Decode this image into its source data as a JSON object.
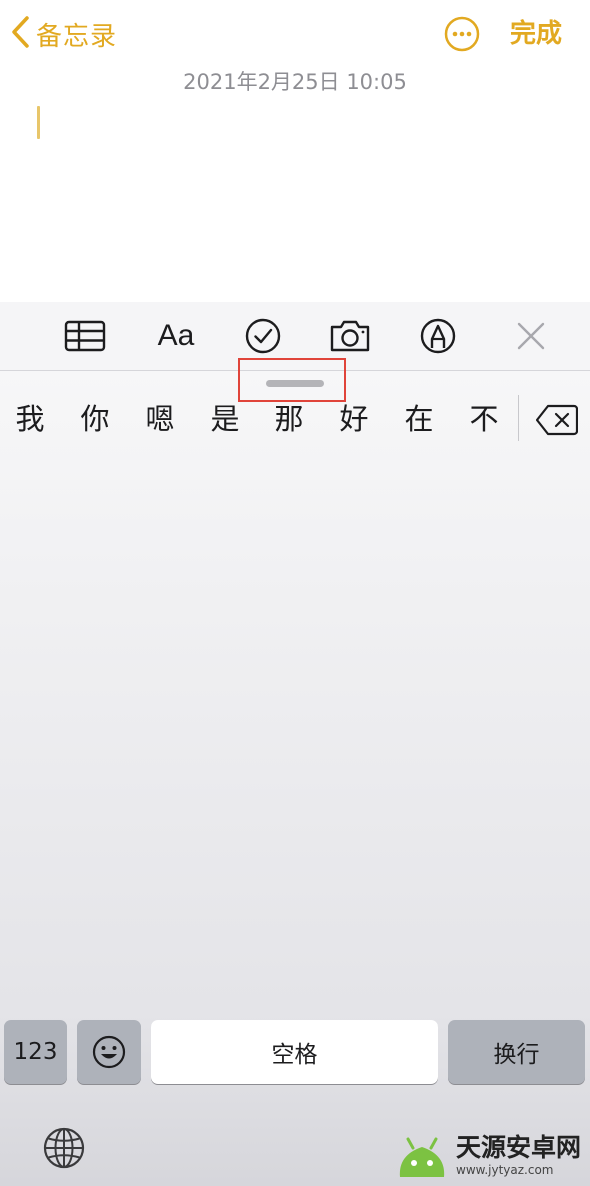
{
  "nav": {
    "back_label": "备忘录",
    "done_label": "完成"
  },
  "note": {
    "timestamp": "2021年2月25日 10:05"
  },
  "toolbar": {
    "items": [
      "table-icon",
      "text-format",
      "checklist-icon",
      "camera-icon",
      "markup-icon",
      "close-icon"
    ],
    "text_format_label": "Aa"
  },
  "candidates": [
    "我",
    "你",
    "嗯",
    "是",
    "那",
    "好",
    "在",
    "不"
  ],
  "keyboard": {
    "numbers_label": "123",
    "space_label": "空格",
    "return_label": "换行"
  },
  "watermark": {
    "title": "天源安卓网",
    "url": "www.jytyaz.com"
  },
  "colors": {
    "accent": "#e2a921",
    "highlight": "#e0443a"
  }
}
